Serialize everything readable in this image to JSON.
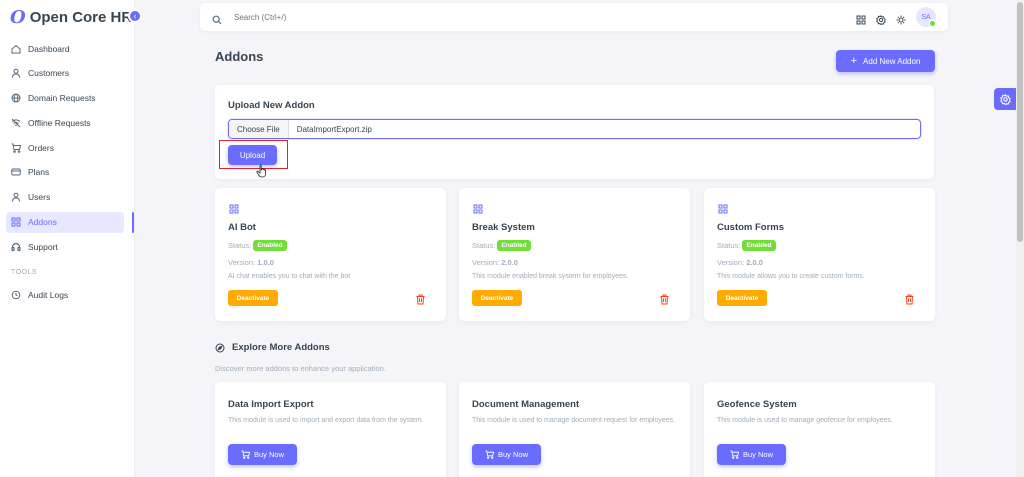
{
  "brand": {
    "logo_glyph": "O",
    "name": "Open Core HR"
  },
  "sidebar": {
    "items": [
      {
        "label": "Dashboard",
        "icon": "home-icon"
      },
      {
        "label": "Customers",
        "icon": "user-icon"
      },
      {
        "label": "Domain Requests",
        "icon": "globe-icon"
      },
      {
        "label": "Offline Requests",
        "icon": "wifi-off-icon"
      },
      {
        "label": "Orders",
        "icon": "cart-icon"
      },
      {
        "label": "Plans",
        "icon": "credit-card-icon"
      },
      {
        "label": "Users",
        "icon": "user-icon"
      },
      {
        "label": "Addons",
        "icon": "grid-icon",
        "active": true
      },
      {
        "label": "Support",
        "icon": "headset-icon"
      }
    ],
    "tools_header": "TOOLS",
    "tools_items": [
      {
        "label": "Audit Logs",
        "icon": "history-icon"
      }
    ]
  },
  "search": {
    "placeholder": "Search (Ctrl+/)"
  },
  "user": {
    "initials": "SA"
  },
  "page": {
    "title": "Addons",
    "add_button": "Add New Addon"
  },
  "upload": {
    "title": "Upload New Addon",
    "choose_label": "Choose File",
    "file_name": "DataImportExport.zip",
    "button": "Upload"
  },
  "installed": [
    {
      "name": "AI Bot",
      "status_label": "Status:",
      "status": "Enabled",
      "version_label": "Version:",
      "version": "1.0.0",
      "description": "AI chat enables you to chat with the bot",
      "action": "Deactivate"
    },
    {
      "name": "Break System",
      "status_label": "Status:",
      "status": "Enabled",
      "version_label": "Version:",
      "version": "2.0.0",
      "description": "This module enabled break system for employees.",
      "action": "Deactivate"
    },
    {
      "name": "Custom Forms",
      "status_label": "Status:",
      "status": "Enabled",
      "version_label": "Version:",
      "version": "2.0.0",
      "description": "This module allows you to create custom forms.",
      "action": "Deactivate"
    }
  ],
  "explore": {
    "title": "Explore More Addons",
    "subtitle": "Discover more addons to enhance your application.",
    "items": [
      {
        "name": "Data Import Export",
        "description": "This module is used to import and export data from the system.",
        "button": "Buy Now"
      },
      {
        "name": "Document Management",
        "description": "This module is used to manage document request for employees.",
        "button": "Buy Now"
      },
      {
        "name": "Geofence System",
        "description": "This module is used to manage geofence for employees.",
        "button": "Buy Now"
      }
    ]
  },
  "colors": {
    "primary": "#696cff",
    "success": "#71dd37",
    "warning": "#ffab00",
    "danger": "#ff3e1d"
  }
}
